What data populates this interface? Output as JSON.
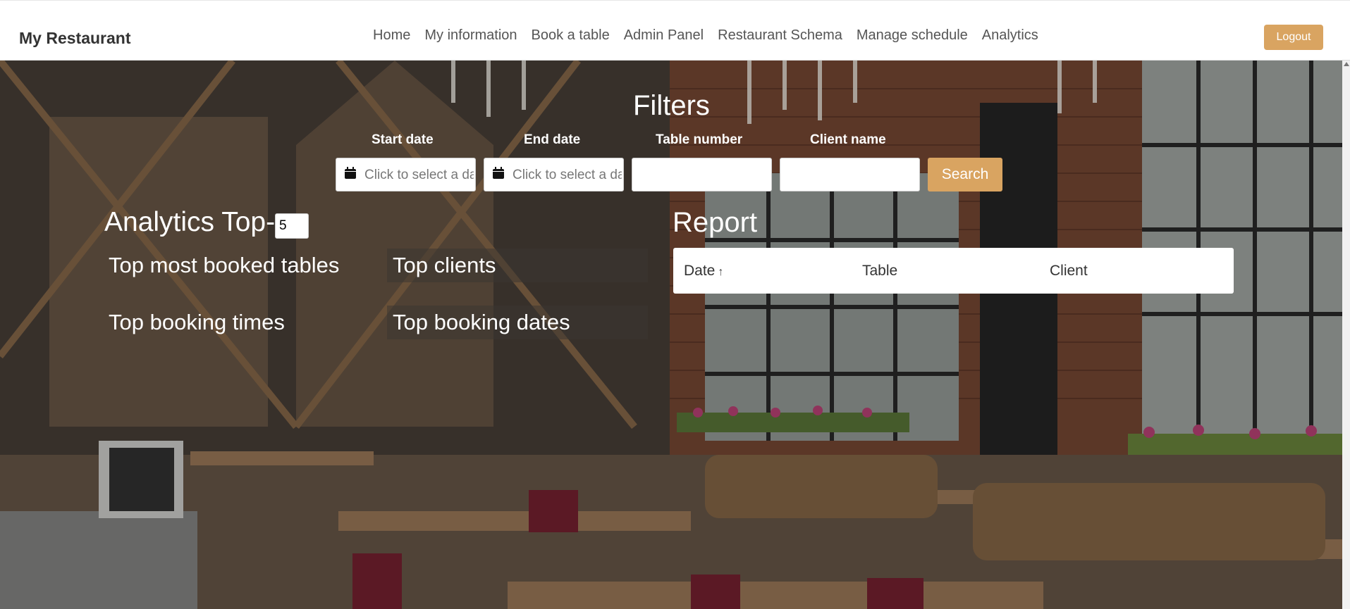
{
  "navbar": {
    "brand": "My Restaurant",
    "links": [
      "Home",
      "My information",
      "Book a table",
      "Admin Panel",
      "Restaurant Schema",
      "Manage schedule",
      "Analytics"
    ],
    "logout_label": "Logout"
  },
  "filters": {
    "title": "Filters",
    "start_date": {
      "label": "Start date",
      "placeholder": "Click to select a date"
    },
    "end_date": {
      "label": "End date",
      "placeholder": "Click to select a date"
    },
    "table_number": {
      "label": "Table number",
      "value": ""
    },
    "client_name": {
      "label": "Client name",
      "value": ""
    },
    "search_label": "Search"
  },
  "analytics": {
    "title": "Analytics Top-",
    "top_n": "5",
    "links": {
      "most_booked_tables": "Top most booked tables",
      "clients": "Top clients",
      "booking_times": "Top booking times",
      "booking_dates": "Top booking dates"
    }
  },
  "report": {
    "title": "Report",
    "columns": {
      "date": "Date",
      "table": "Table",
      "client": "Client"
    },
    "sort_indicator": "↑",
    "rows": []
  },
  "colors": {
    "accent": "#d9a461",
    "nav_text": "#555555",
    "brand_text": "#333333"
  }
}
